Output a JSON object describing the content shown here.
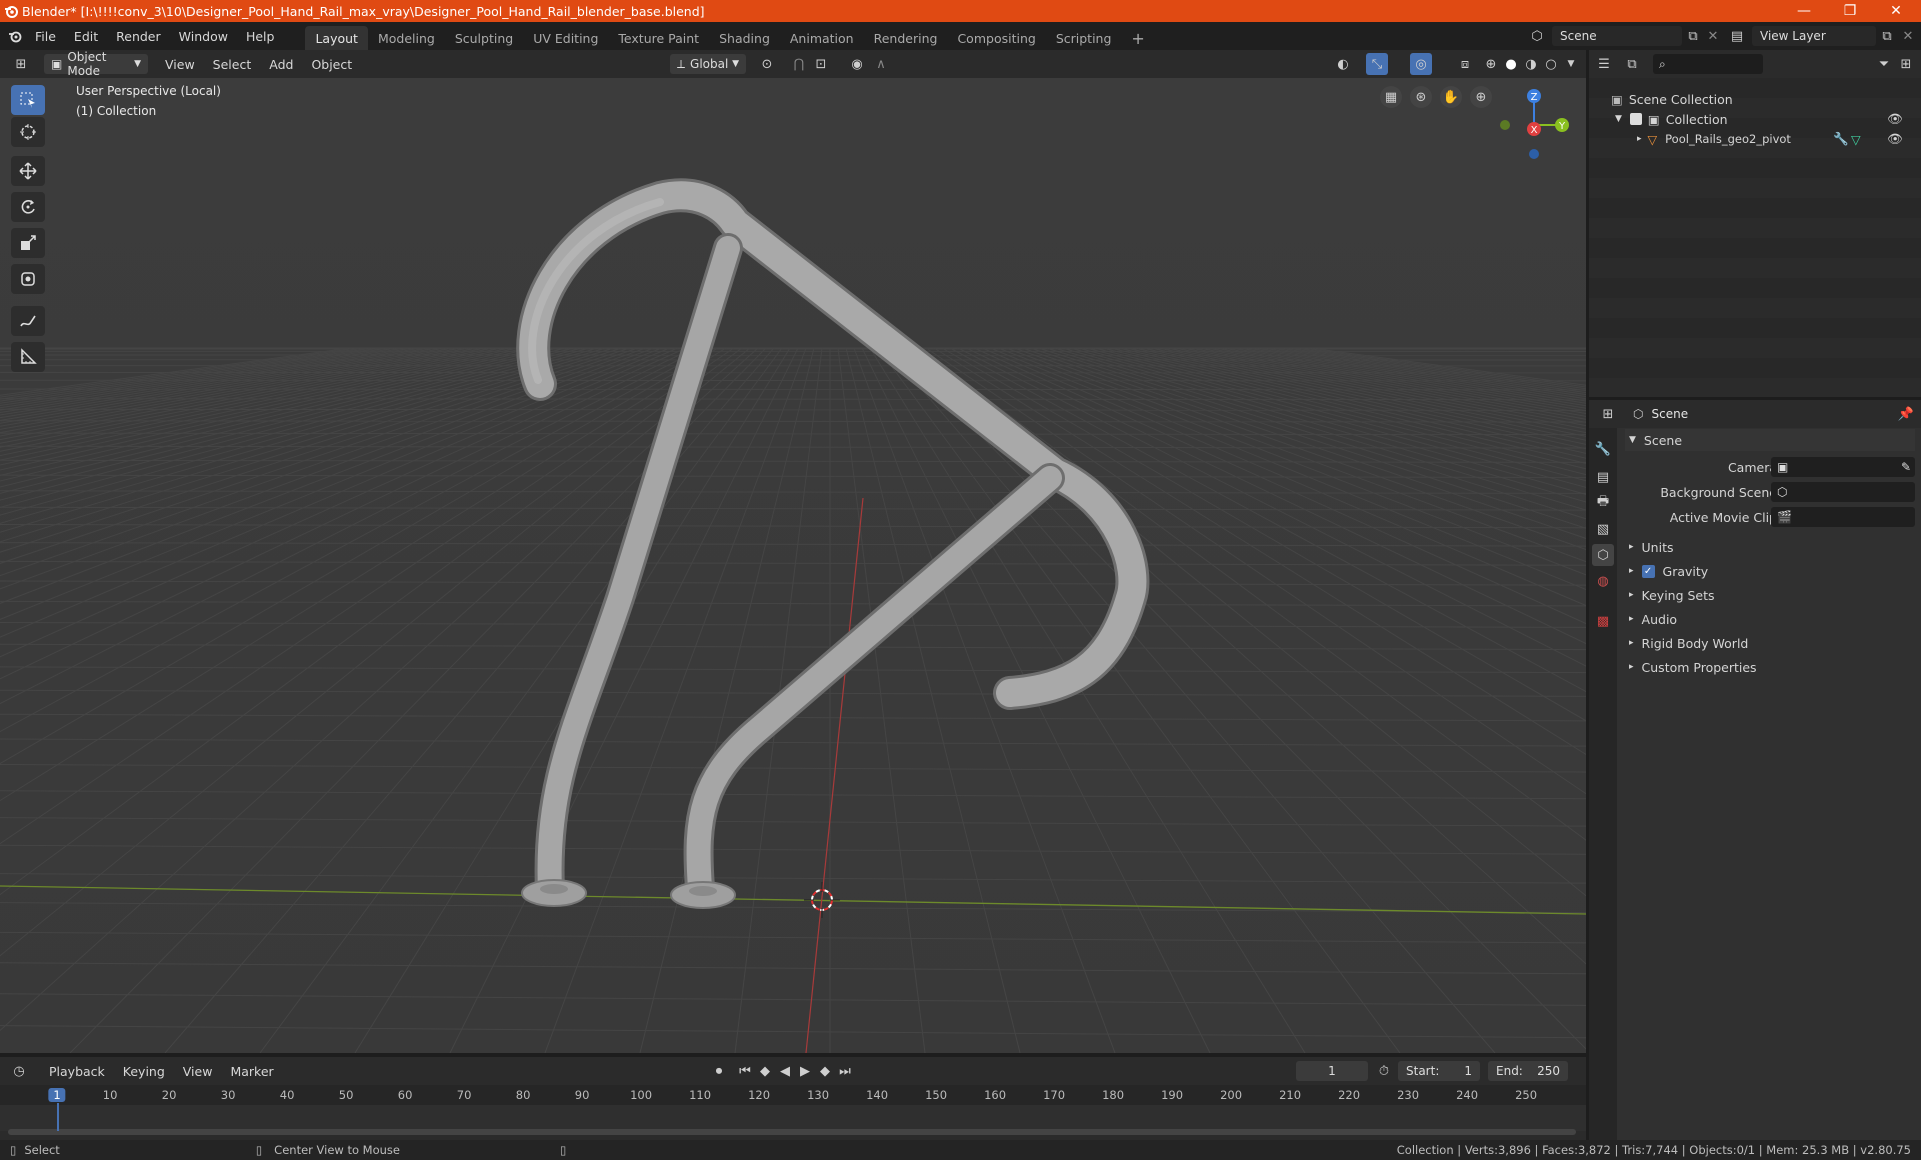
{
  "window": {
    "title": "Blender* [I:\\!!!!conv_3\\10\\Designer_Pool_Hand_Rail_max_vray\\Designer_Pool_Hand_Rail_blender_base.blend]"
  },
  "menu": {
    "items": [
      "File",
      "Edit",
      "Render",
      "Window",
      "Help"
    ]
  },
  "workspaces": {
    "tabs": [
      "Layout",
      "Modeling",
      "Sculpting",
      "UV Editing",
      "Texture Paint",
      "Shading",
      "Animation",
      "Rendering",
      "Compositing",
      "Scripting"
    ],
    "active": "Layout"
  },
  "scene": {
    "name": "Scene",
    "view_layer": "View Layer"
  },
  "viewport_header": {
    "mode": "Object Mode",
    "menus": [
      "View",
      "Select",
      "Add",
      "Object"
    ],
    "orientation": "Global"
  },
  "viewport": {
    "perspective": "User Perspective (Local)",
    "collection": "(1) Collection",
    "axis_x": "X",
    "axis_y": "Y",
    "axis_z": "Z"
  },
  "outliner": {
    "root": "Scene Collection",
    "collection": "Collection",
    "object": "Pool_Rails_geo2_pivot"
  },
  "properties": {
    "context": "Scene",
    "panel": "Scene",
    "camera_label": "Camera",
    "bg_scene_label": "Background Scene",
    "movie_clip_label": "Active Movie Clip",
    "sections": [
      "Units",
      "Gravity",
      "Keying Sets",
      "Audio",
      "Rigid Body World",
      "Custom Properties"
    ]
  },
  "timeline": {
    "menus": [
      "Playback",
      "Keying",
      "View",
      "Marker"
    ],
    "current_frame": "1",
    "start_label": "Start:",
    "start": "1",
    "end_label": "End:",
    "end": "250",
    "ruler": [
      "1",
      "10",
      "20",
      "30",
      "40",
      "50",
      "60",
      "70",
      "80",
      "90",
      "100",
      "110",
      "120",
      "130",
      "140",
      "150",
      "160",
      "170",
      "180",
      "190",
      "200",
      "210",
      "220",
      "230",
      "240",
      "250"
    ]
  },
  "statusbar": {
    "select": "Select",
    "center": "Center View to Mouse",
    "stats": "Collection | Verts:3,896 | Faces:3,872 | Tris:7,744 | Objects:0/1 | Mem: 25.3 MB | v2.80.75"
  },
  "colors": {
    "titlebar": "#e04a13",
    "accent": "#4772b3",
    "viewport": "#3d3d3d"
  }
}
